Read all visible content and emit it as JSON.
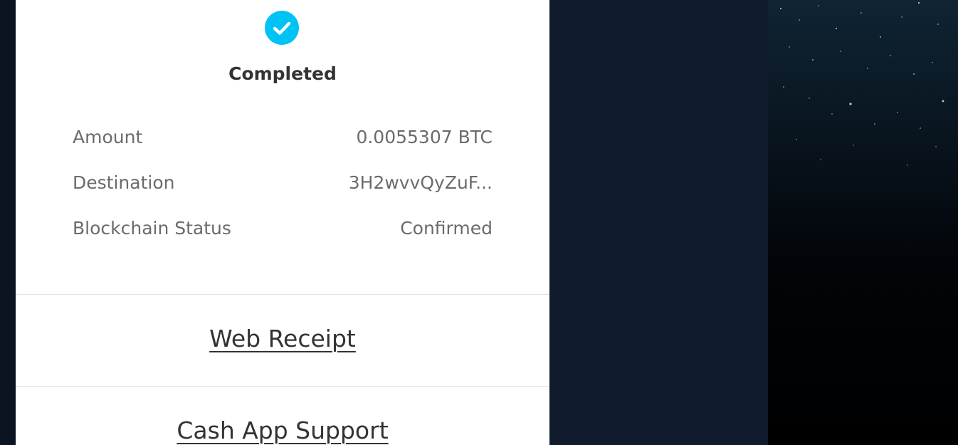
{
  "transaction": {
    "status": "Completed",
    "details": [
      {
        "label": "Amount",
        "value": "0.0055307 BTC"
      },
      {
        "label": "Destination",
        "value": "3H2wvvQyZuF..."
      },
      {
        "label": "Blockchain Status",
        "value": "Confirmed"
      }
    ]
  },
  "actions": {
    "web_receipt": "Web Receipt",
    "support": "Cash App Support"
  },
  "icons": {
    "status": "check-circle-icon"
  },
  "colors": {
    "accent": "#00c3f5",
    "card_background": "#ffffff",
    "backdrop": "#0f1b2c",
    "text_primary": "#333333",
    "text_secondary": "#6b6b6b"
  }
}
